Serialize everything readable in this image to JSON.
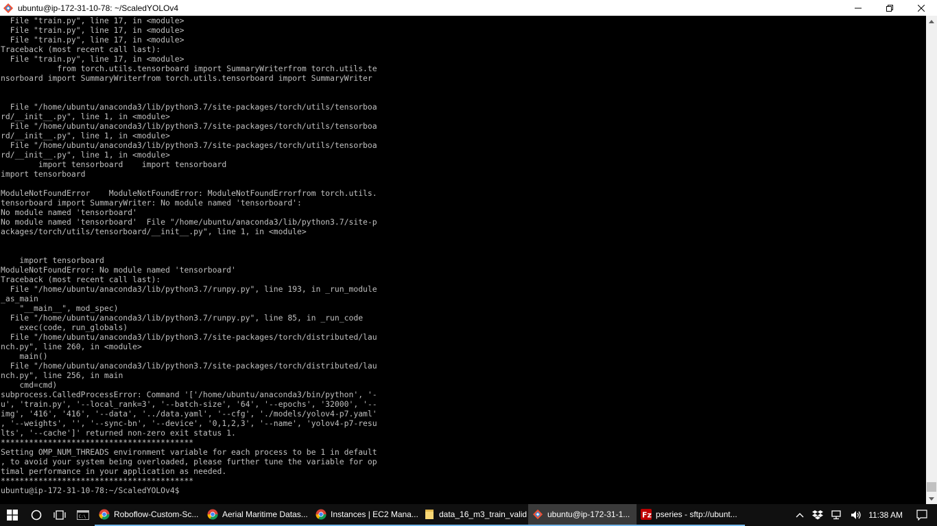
{
  "window": {
    "title": "ubuntu@ip-172-31-10-78: ~/ScaledYOLOv4"
  },
  "terminal": {
    "lines": [
      "  File \"train.py\", line 17, in <module>",
      "  File \"train.py\", line 17, in <module>",
      "  File \"train.py\", line 17, in <module>",
      "Traceback (most recent call last):",
      "  File \"train.py\", line 17, in <module>",
      "            from torch.utils.tensorboard import SummaryWriterfrom torch.utils.te",
      "nsorboard import SummaryWriterfrom torch.utils.tensorboard import SummaryWriter",
      "",
      "",
      "  File \"/home/ubuntu/anaconda3/lib/python3.7/site-packages/torch/utils/tensorboa",
      "rd/__init__.py\", line 1, in <module>",
      "  File \"/home/ubuntu/anaconda3/lib/python3.7/site-packages/torch/utils/tensorboa",
      "rd/__init__.py\", line 1, in <module>",
      "  File \"/home/ubuntu/anaconda3/lib/python3.7/site-packages/torch/utils/tensorboa",
      "rd/__init__.py\", line 1, in <module>",
      "        import tensorboard    import tensorboard",
      "import tensorboard",
      "",
      "ModuleNotFoundError    ModuleNotFoundError: ModuleNotFoundErrorfrom torch.utils.",
      "tensorboard import SummaryWriter: No module named 'tensorboard':",
      "No module named 'tensorboard'",
      "No module named 'tensorboard'  File \"/home/ubuntu/anaconda3/lib/python3.7/site-p",
      "ackages/torch/utils/tensorboard/__init__.py\", line 1, in <module>",
      "",
      "",
      "    import tensorboard",
      "ModuleNotFoundError: No module named 'tensorboard'",
      "Traceback (most recent call last):",
      "  File \"/home/ubuntu/anaconda3/lib/python3.7/runpy.py\", line 193, in _run_module",
      "_as_main",
      "    \"__main__\", mod_spec)",
      "  File \"/home/ubuntu/anaconda3/lib/python3.7/runpy.py\", line 85, in _run_code",
      "    exec(code, run_globals)",
      "  File \"/home/ubuntu/anaconda3/lib/python3.7/site-packages/torch/distributed/lau",
      "nch.py\", line 260, in <module>",
      "    main()",
      "  File \"/home/ubuntu/anaconda3/lib/python3.7/site-packages/torch/distributed/lau",
      "nch.py\", line 256, in main",
      "    cmd=cmd)",
      "subprocess.CalledProcessError: Command '['/home/ubuntu/anaconda3/bin/python', '-",
      "u', 'train.py', '--local_rank=3', '--batch-size', '64', '--epochs', '32000', '--",
      "img', '416', '416', '--data', '../data.yaml', '--cfg', './models/yolov4-p7.yaml'",
      ", '--weights', '', '--sync-bn', '--device', '0,1,2,3', '--name', 'yolov4-p7-resu",
      "lts', '--cache']' returned non-zero exit status 1.",
      "*****************************************",
      "Setting OMP_NUM_THREADS environment variable for each process to be 1 in default",
      ", to avoid your system being overloaded, please further tune the variable for op",
      "timal performance in your application as needed.",
      "*****************************************",
      "ubuntu@ip-172-31-10-78:~/ScaledYOLOv4$ "
    ]
  },
  "taskbar": {
    "tasks": [
      {
        "label": "Roboflow-Custom-Sc...",
        "icon": "chrome-icon"
      },
      {
        "label": "Aerial Maritime Datas...",
        "icon": "chrome-icon"
      },
      {
        "label": "Instances | EC2 Mana...",
        "icon": "chrome-icon"
      },
      {
        "label": "data_16_m3_train_valid",
        "icon": "folder-icon"
      },
      {
        "label": "ubuntu@ip-172-31-1...",
        "icon": "git-bash-icon"
      },
      {
        "label": "pseries - sftp://ubunt...",
        "icon": "filezilla-icon"
      }
    ],
    "clock": "11:38 AM"
  },
  "colors": {
    "terminal_bg": "#000000",
    "terminal_fg": "#c0c0c0",
    "taskbar_bg": "#101010",
    "task_underline": "#76b9ed"
  }
}
